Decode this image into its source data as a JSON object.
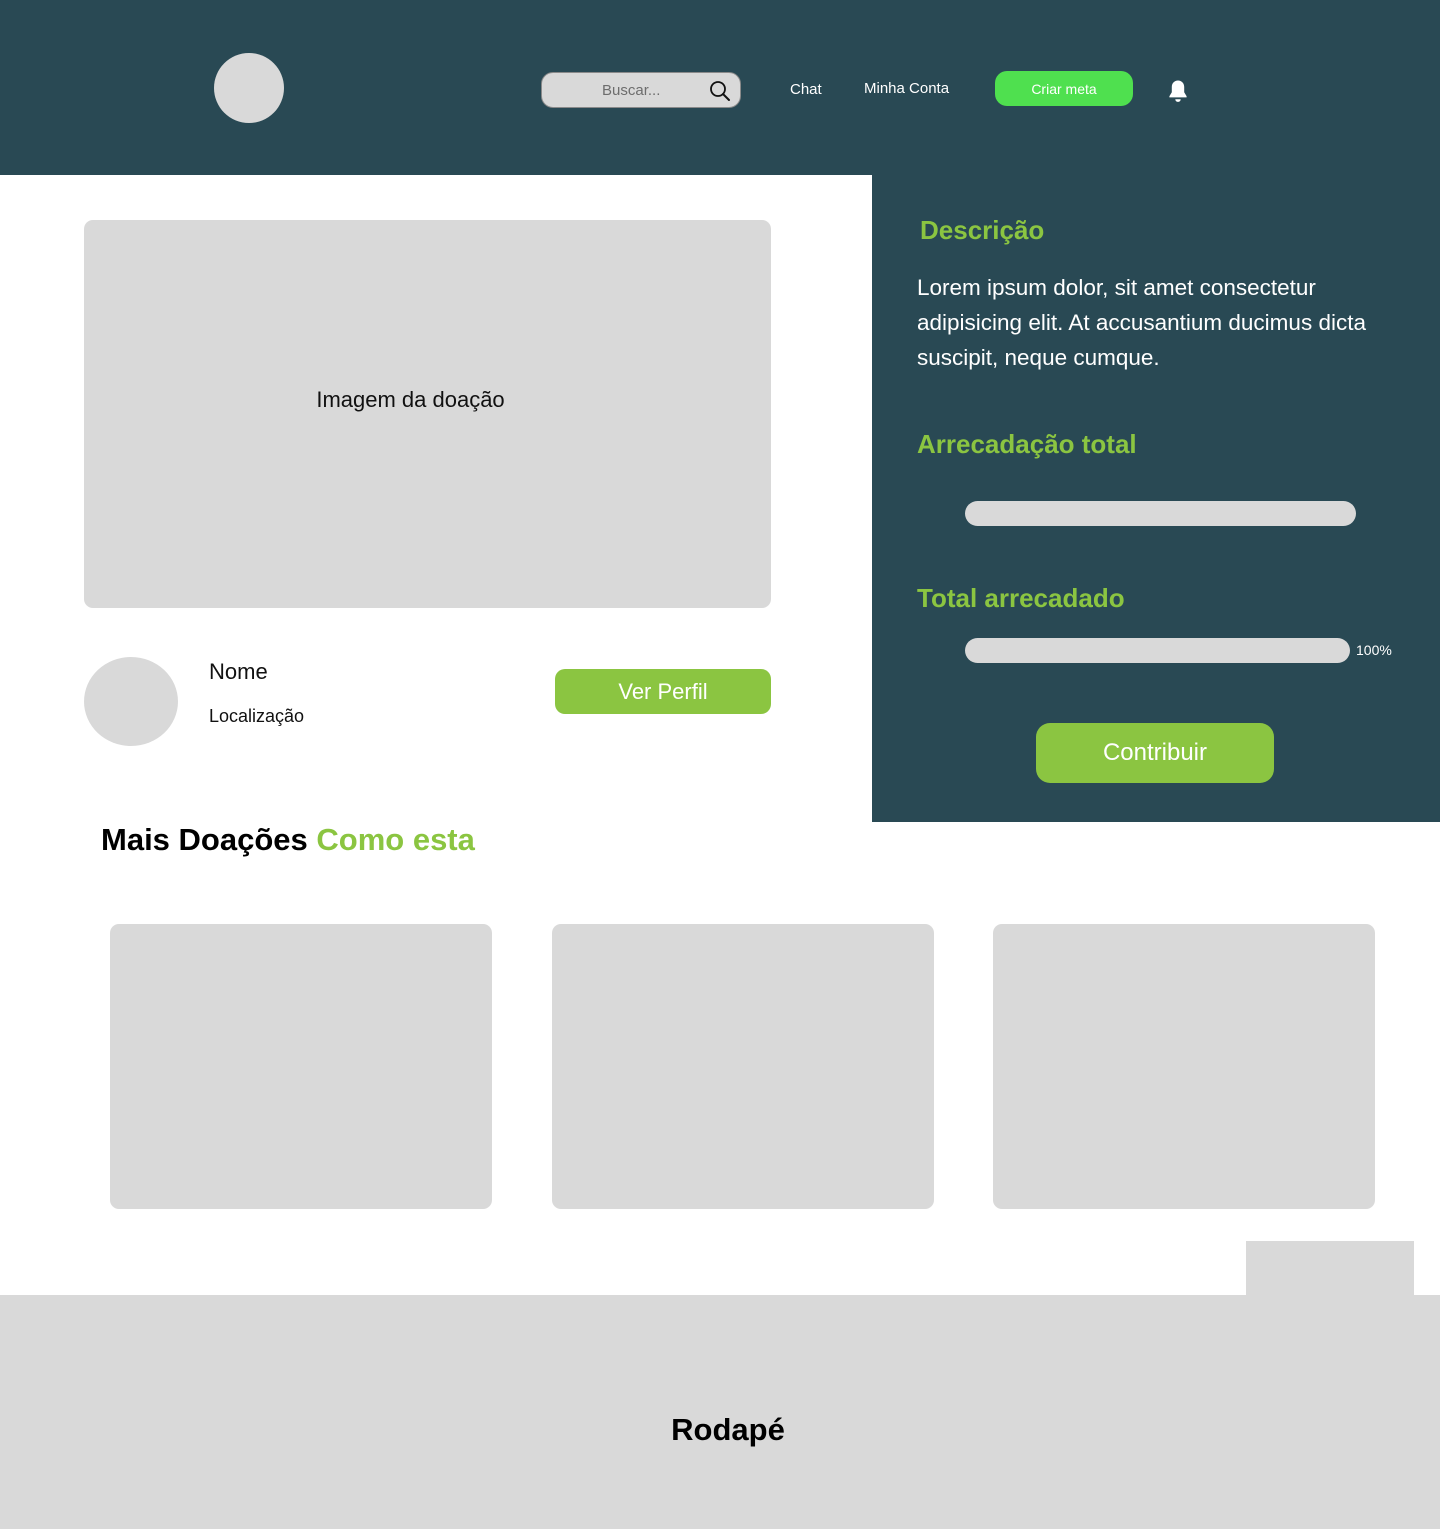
{
  "colors": {
    "header_bg": "#294954",
    "accent_green": "#8bc541",
    "create_button_green": "#4fe04f",
    "placeholder_gray": "#d9d9d9"
  },
  "header": {
    "search": {
      "placeholder": "Buscar..."
    },
    "nav": {
      "chat": "Chat",
      "account": "Minha Conta"
    },
    "create_button": "Criar meta",
    "icons": {
      "search": "search-icon",
      "notifications": "bell-icon"
    }
  },
  "donation": {
    "image_label": "Imagem da doação",
    "owner": {
      "name": "Nome",
      "location": "Localização",
      "view_profile": "Ver Perfil"
    }
  },
  "details": {
    "description_heading": "Descrição",
    "description_text": "Lorem ipsum dolor, sit amet consectetur adipisicing elit. At accusantium ducimus dicta suscipit, neque cumque.",
    "collection_heading": "Arrecadação total",
    "collection_progress": 1.0,
    "total_heading": "Total arrecadado",
    "total_progress": 1.0,
    "total_percent": "100%",
    "contribute_button": "Contribuir"
  },
  "more": {
    "title_main": "Mais Doações",
    "title_accent": "Como esta",
    "card_count": 3
  },
  "footer": {
    "title": "Rodapé"
  }
}
